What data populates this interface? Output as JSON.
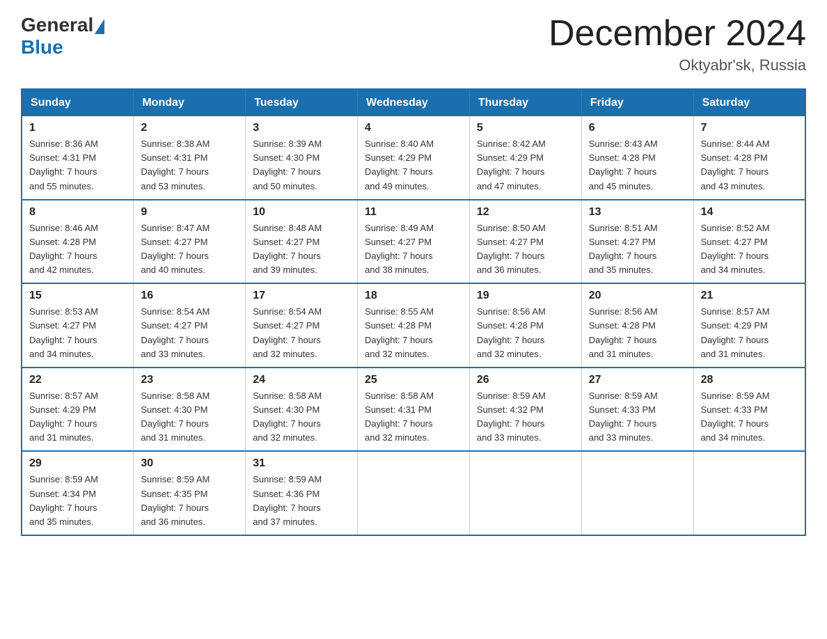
{
  "header": {
    "logo": {
      "general": "General",
      "blue": "Blue"
    },
    "title": "December 2024",
    "location": "Oktyabr'sk, Russia"
  },
  "days_of_week": [
    "Sunday",
    "Monday",
    "Tuesday",
    "Wednesday",
    "Thursday",
    "Friday",
    "Saturday"
  ],
  "weeks": [
    [
      {
        "day": "1",
        "info": "Sunrise: 8:36 AM\nSunset: 4:31 PM\nDaylight: 7 hours\nand 55 minutes."
      },
      {
        "day": "2",
        "info": "Sunrise: 8:38 AM\nSunset: 4:31 PM\nDaylight: 7 hours\nand 53 minutes."
      },
      {
        "day": "3",
        "info": "Sunrise: 8:39 AM\nSunset: 4:30 PM\nDaylight: 7 hours\nand 50 minutes."
      },
      {
        "day": "4",
        "info": "Sunrise: 8:40 AM\nSunset: 4:29 PM\nDaylight: 7 hours\nand 49 minutes."
      },
      {
        "day": "5",
        "info": "Sunrise: 8:42 AM\nSunset: 4:29 PM\nDaylight: 7 hours\nand 47 minutes."
      },
      {
        "day": "6",
        "info": "Sunrise: 8:43 AM\nSunset: 4:28 PM\nDaylight: 7 hours\nand 45 minutes."
      },
      {
        "day": "7",
        "info": "Sunrise: 8:44 AM\nSunset: 4:28 PM\nDaylight: 7 hours\nand 43 minutes."
      }
    ],
    [
      {
        "day": "8",
        "info": "Sunrise: 8:46 AM\nSunset: 4:28 PM\nDaylight: 7 hours\nand 42 minutes."
      },
      {
        "day": "9",
        "info": "Sunrise: 8:47 AM\nSunset: 4:27 PM\nDaylight: 7 hours\nand 40 minutes."
      },
      {
        "day": "10",
        "info": "Sunrise: 8:48 AM\nSunset: 4:27 PM\nDaylight: 7 hours\nand 39 minutes."
      },
      {
        "day": "11",
        "info": "Sunrise: 8:49 AM\nSunset: 4:27 PM\nDaylight: 7 hours\nand 38 minutes."
      },
      {
        "day": "12",
        "info": "Sunrise: 8:50 AM\nSunset: 4:27 PM\nDaylight: 7 hours\nand 36 minutes."
      },
      {
        "day": "13",
        "info": "Sunrise: 8:51 AM\nSunset: 4:27 PM\nDaylight: 7 hours\nand 35 minutes."
      },
      {
        "day": "14",
        "info": "Sunrise: 8:52 AM\nSunset: 4:27 PM\nDaylight: 7 hours\nand 34 minutes."
      }
    ],
    [
      {
        "day": "15",
        "info": "Sunrise: 8:53 AM\nSunset: 4:27 PM\nDaylight: 7 hours\nand 34 minutes."
      },
      {
        "day": "16",
        "info": "Sunrise: 8:54 AM\nSunset: 4:27 PM\nDaylight: 7 hours\nand 33 minutes."
      },
      {
        "day": "17",
        "info": "Sunrise: 8:54 AM\nSunset: 4:27 PM\nDaylight: 7 hours\nand 32 minutes."
      },
      {
        "day": "18",
        "info": "Sunrise: 8:55 AM\nSunset: 4:28 PM\nDaylight: 7 hours\nand 32 minutes."
      },
      {
        "day": "19",
        "info": "Sunrise: 8:56 AM\nSunset: 4:28 PM\nDaylight: 7 hours\nand 32 minutes."
      },
      {
        "day": "20",
        "info": "Sunrise: 8:56 AM\nSunset: 4:28 PM\nDaylight: 7 hours\nand 31 minutes."
      },
      {
        "day": "21",
        "info": "Sunrise: 8:57 AM\nSunset: 4:29 PM\nDaylight: 7 hours\nand 31 minutes."
      }
    ],
    [
      {
        "day": "22",
        "info": "Sunrise: 8:57 AM\nSunset: 4:29 PM\nDaylight: 7 hours\nand 31 minutes."
      },
      {
        "day": "23",
        "info": "Sunrise: 8:58 AM\nSunset: 4:30 PM\nDaylight: 7 hours\nand 31 minutes."
      },
      {
        "day": "24",
        "info": "Sunrise: 8:58 AM\nSunset: 4:30 PM\nDaylight: 7 hours\nand 32 minutes."
      },
      {
        "day": "25",
        "info": "Sunrise: 8:58 AM\nSunset: 4:31 PM\nDaylight: 7 hours\nand 32 minutes."
      },
      {
        "day": "26",
        "info": "Sunrise: 8:59 AM\nSunset: 4:32 PM\nDaylight: 7 hours\nand 33 minutes."
      },
      {
        "day": "27",
        "info": "Sunrise: 8:59 AM\nSunset: 4:33 PM\nDaylight: 7 hours\nand 33 minutes."
      },
      {
        "day": "28",
        "info": "Sunrise: 8:59 AM\nSunset: 4:33 PM\nDaylight: 7 hours\nand 34 minutes."
      }
    ],
    [
      {
        "day": "29",
        "info": "Sunrise: 8:59 AM\nSunset: 4:34 PM\nDaylight: 7 hours\nand 35 minutes."
      },
      {
        "day": "30",
        "info": "Sunrise: 8:59 AM\nSunset: 4:35 PM\nDaylight: 7 hours\nand 36 minutes."
      },
      {
        "day": "31",
        "info": "Sunrise: 8:59 AM\nSunset: 4:36 PM\nDaylight: 7 hours\nand 37 minutes."
      },
      {
        "day": "",
        "info": ""
      },
      {
        "day": "",
        "info": ""
      },
      {
        "day": "",
        "info": ""
      },
      {
        "day": "",
        "info": ""
      }
    ]
  ]
}
